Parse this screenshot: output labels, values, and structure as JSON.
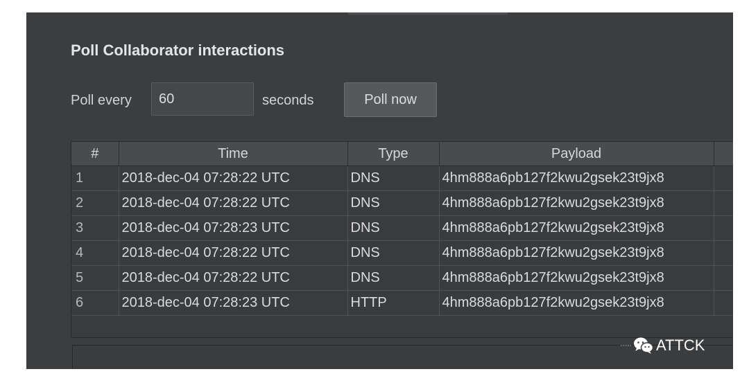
{
  "panel": {
    "title": "Poll Collaborator interactions",
    "poll_label": "Poll every",
    "poll_value": "60",
    "seconds_label": "seconds",
    "poll_now_label": "Poll now"
  },
  "table": {
    "headers": {
      "num": "#",
      "time": "Time",
      "type": "Type",
      "payload": "Payload"
    },
    "rows": [
      {
        "num": "1",
        "time": "2018-dec-04 07:28:22 UTC",
        "type": "DNS",
        "payload": "4hm888a6pb127f2kwu2gsek23t9jx8"
      },
      {
        "num": "2",
        "time": "2018-dec-04 07:28:22 UTC",
        "type": "DNS",
        "payload": "4hm888a6pb127f2kwu2gsek23t9jx8"
      },
      {
        "num": "3",
        "time": "2018-dec-04 07:28:23 UTC",
        "type": "DNS",
        "payload": "4hm888a6pb127f2kwu2gsek23t9jx8"
      },
      {
        "num": "4",
        "time": "2018-dec-04 07:28:22 UTC",
        "type": "DNS",
        "payload": "4hm888a6pb127f2kwu2gsek23t9jx8"
      },
      {
        "num": "5",
        "time": "2018-dec-04 07:28:22 UTC",
        "type": "DNS",
        "payload": "4hm888a6pb127f2kwu2gsek23t9jx8"
      },
      {
        "num": "6",
        "time": "2018-dec-04 07:28:23 UTC",
        "type": "HTTP",
        "payload": "4hm888a6pb127f2kwu2gsek23t9jx8"
      }
    ]
  },
  "watermark": {
    "icon": "wechat-icon",
    "text": "ATTCK"
  },
  "colors": {
    "panel_bg": "#3c3d3f",
    "header_bg": "#4a4b4d",
    "text": "#dadbdd"
  }
}
